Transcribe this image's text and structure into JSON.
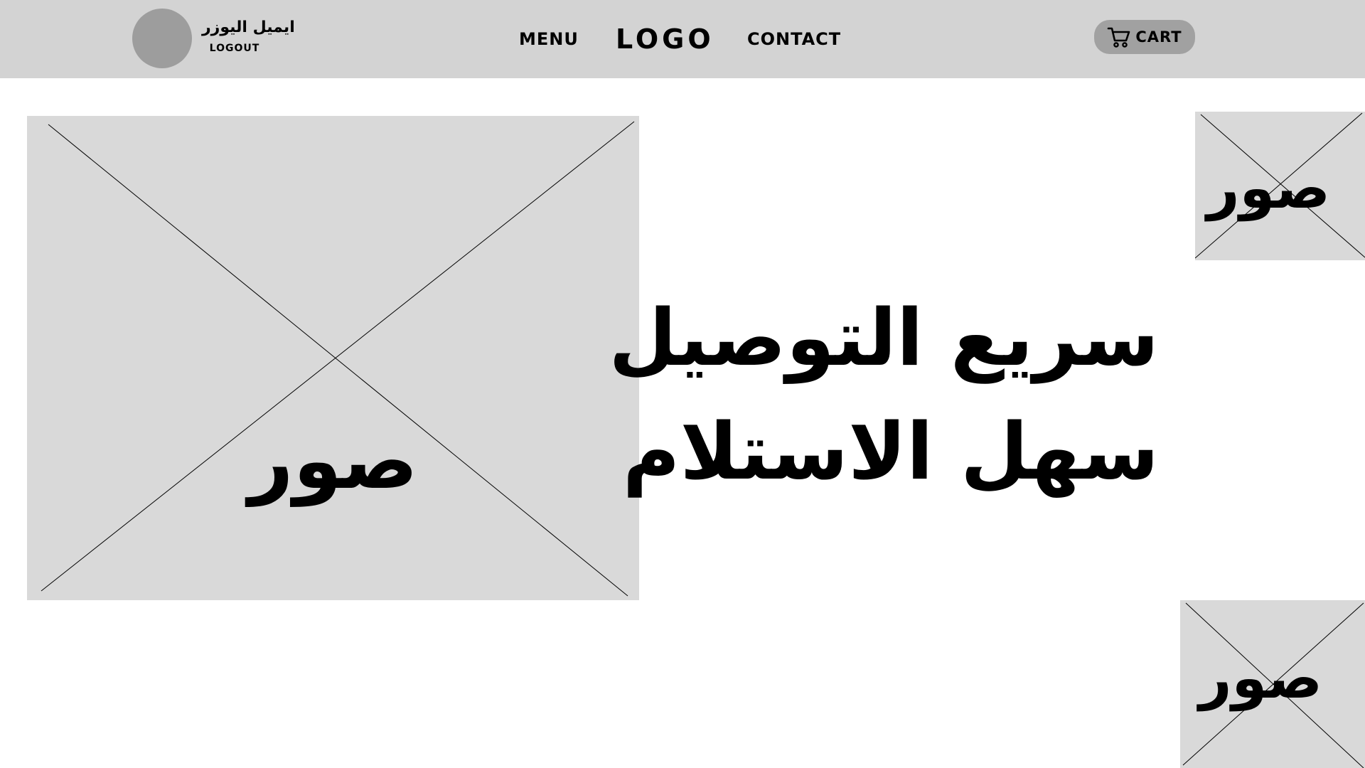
{
  "header": {
    "user_name": "ايميل اليوزر",
    "logout_label": "LOGOUT",
    "nav_menu": "MENU",
    "logo": "LOGO",
    "nav_contact": "CONTACT",
    "cart_label": "CART",
    "cart_icon": "cart-icon",
    "bar_color": "#d3d3d3",
    "avatar_color": "#9d9d9d",
    "cart_button_color": "#a1a1a1"
  },
  "images": {
    "main_label": "صور",
    "top_right_label": "صور",
    "bottom_right_label": "صور",
    "placeholder_color": "#d9d9d9"
  },
  "hero": {
    "line1": "سريع التوصيل",
    "line2": "سهل الاستلام"
  }
}
